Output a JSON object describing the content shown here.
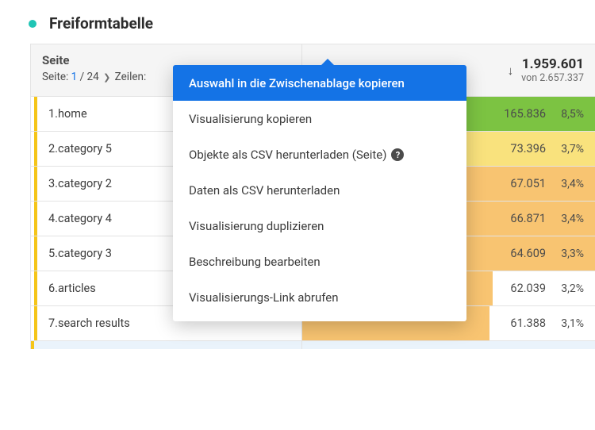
{
  "title": "Freiformtabelle",
  "header": {
    "dimension_label": "Seite",
    "pager_prefix": "Seite:",
    "pager_current": "1",
    "pager_total": "24",
    "rows_label": "Zeilen:"
  },
  "metric": {
    "total": "1.959.601",
    "sub_prefix": "von",
    "sub_value": "2.657.337"
  },
  "rows": [
    {
      "idx": "1.",
      "label": "home",
      "value": "165.836",
      "pct": "8,5%",
      "bar_class": "bar-green",
      "bar_css_width": "100%"
    },
    {
      "idx": "2.",
      "label": "category 5",
      "value": "73.396",
      "pct": "3,7%",
      "bar_class": "bar-yellow",
      "bar_css_width": "100%"
    },
    {
      "idx": "3.",
      "label": "category 2",
      "value": "67.051",
      "pct": "3,4%",
      "bar_class": "bar-orange",
      "bar_css_width": "100%"
    },
    {
      "idx": "4.",
      "label": "category 4",
      "value": "66.871",
      "pct": "3,4%",
      "bar_class": "bar-orange",
      "bar_css_width": "100%"
    },
    {
      "idx": "5.",
      "label": "category 3",
      "value": "64.609",
      "pct": "3,3%",
      "bar_class": "bar-orange",
      "bar_css_width": "100%"
    },
    {
      "idx": "6.",
      "label": "articles",
      "value": "62.039",
      "pct": "3,2%",
      "bar_class": "bar-orange",
      "bar_css_width": "65%"
    },
    {
      "idx": "7.",
      "label": "search results",
      "value": "61.388",
      "pct": "3,1%",
      "bar_class": "bar-orange",
      "bar_css_width": "64%"
    }
  ],
  "menu": {
    "items": [
      {
        "label": "Auswahl in die Zwischenablage kopieren",
        "highlight": true,
        "help": false
      },
      {
        "label": "Visualisierung kopieren",
        "highlight": false,
        "help": false
      },
      {
        "label": "Objekte als CSV herunterladen (Seite)",
        "highlight": false,
        "help": true
      },
      {
        "label": "Daten als CSV herunterladen",
        "highlight": false,
        "help": false
      },
      {
        "label": "Visualisierung duplizieren",
        "highlight": false,
        "help": false
      },
      {
        "label": "Beschreibung bearbeiten",
        "highlight": false,
        "help": false
      },
      {
        "label": "Visualisierungs-Link abrufen",
        "highlight": false,
        "help": false
      }
    ]
  }
}
